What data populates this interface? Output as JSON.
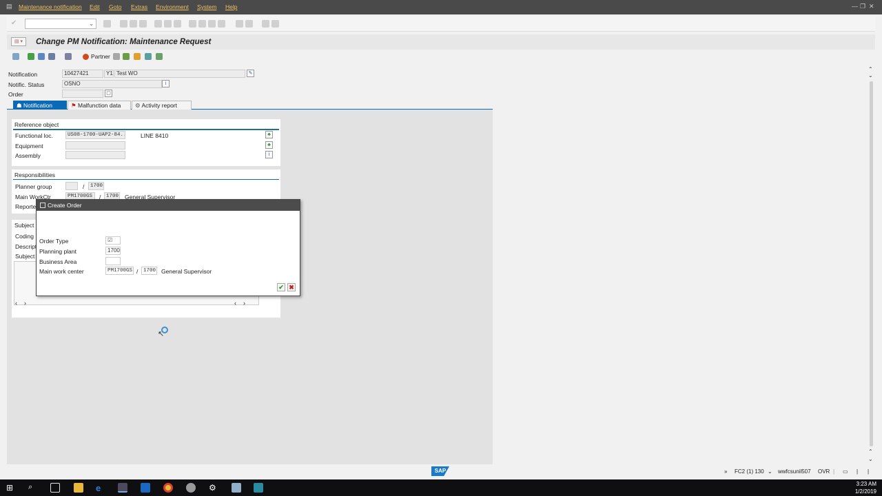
{
  "menu": {
    "items": [
      "Maintenance notification",
      "Edit",
      "Goto",
      "Extras",
      "Environment",
      "System",
      "Help"
    ]
  },
  "title": {
    "text": "Change PM Notification: Maintenance Request"
  },
  "app_toolbar": {
    "partner_label": "Partner"
  },
  "header": {
    "notification_label": "Notification",
    "notification_number": "10427421",
    "notification_type": "Y1",
    "notification_desc": "Test WO",
    "status_label": "Notific. Status",
    "status_value": "OSNO",
    "order_label": "Order",
    "order_value": ""
  },
  "tabs": [
    {
      "label": "Notification",
      "active": true
    },
    {
      "label": "Malfunction data",
      "active": false
    },
    {
      "label": "Activity report",
      "active": false
    }
  ],
  "reference_object": {
    "title": "Reference object",
    "functional_loc_label": "Functional loc.",
    "functional_loc_value": "US08-1700-UAP2-84..",
    "functional_loc_desc": "LINE 8410",
    "equipment_label": "Equipment",
    "assembly_label": "Assembly"
  },
  "responsibilities": {
    "title": "Responsibilities",
    "planner_group_label": "Planner group",
    "planner_group_value": "",
    "planner_plant": "1700",
    "main_workctr_label": "Main WorkCtr",
    "main_workctr_value": "PM1700GS",
    "main_workctr_plant": "1700",
    "main_workctr_desc": "General Supervisor",
    "reported_label": "Reporte"
  },
  "subject": {
    "title": "Subject",
    "coding_label": "Coding",
    "description_label": "Descripti",
    "subject_label": "Subject"
  },
  "dialog": {
    "title": "Create Order",
    "order_type_label": "Order Type",
    "planning_plant_label": "Planning plant",
    "planning_plant_value": "1700",
    "business_area_label": "Business Area",
    "business_area_value": "",
    "main_work_center_label": "Main work center",
    "main_work_center_value": "PM1700GS",
    "main_work_center_plant": "1700",
    "main_work_center_desc": "General Supervisor"
  },
  "status_bar": {
    "system": "FC2 (1) 130",
    "server": "wwfcsunil507",
    "mode": "OVR"
  },
  "taskbar": {
    "time": "3:23 AM",
    "date": "1/2/2019"
  },
  "colors": {
    "accent": "#0a6ab6",
    "menubar": "#4a4a4a",
    "menu_text": "#f0c060",
    "dialog_title": "#4c4c4c"
  }
}
